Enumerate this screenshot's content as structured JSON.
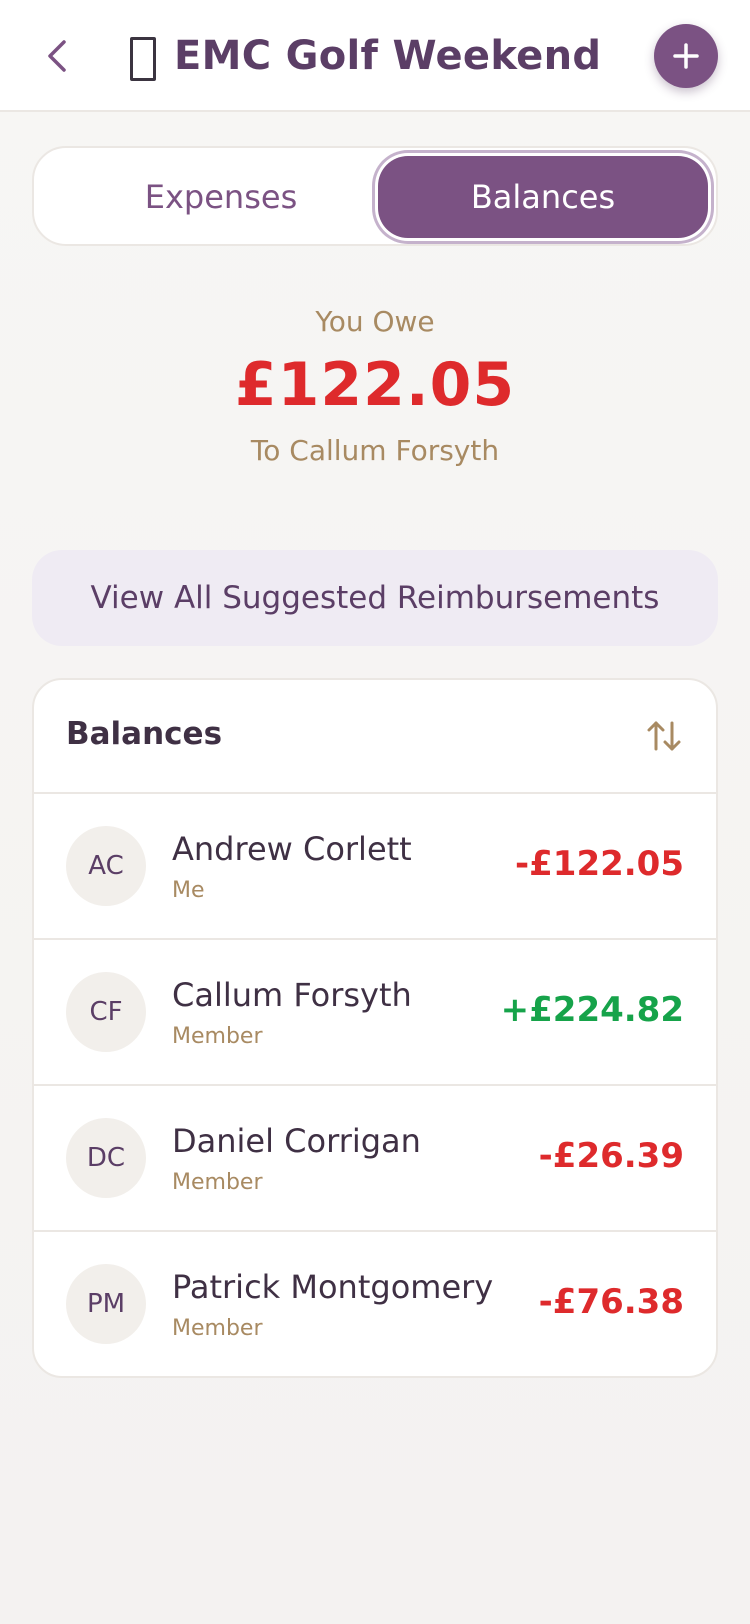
{
  "header": {
    "title": "EMC Golf Weekend",
    "back_icon": "chevron-left-icon",
    "add_icon": "plus-icon"
  },
  "tabs": [
    {
      "label": "Expenses",
      "active": false
    },
    {
      "label": "Balances",
      "active": true
    }
  ],
  "summary": {
    "label": "You Owe",
    "amount": "£122.05",
    "to": "To Callum Forsyth"
  },
  "reimbursements_button": "View All Suggested Reimbursements",
  "balances": {
    "title": "Balances",
    "sort_icon": "sort-arrows-icon",
    "rows": [
      {
        "initials": "AC",
        "name": "Andrew Corlett",
        "role": "Me",
        "amount": "-£122.05"
      },
      {
        "initials": "CF",
        "name": "Callum Forsyth",
        "role": "Member",
        "amount": "+£224.82"
      },
      {
        "initials": "DC",
        "name": "Daniel Corrigan",
        "role": "Member",
        "amount": "-£26.39"
      },
      {
        "initials": "PM",
        "name": "Patrick Montgomery",
        "role": "Member",
        "amount": "-£76.38"
      }
    ]
  },
  "colors": {
    "brand": "#7b5283",
    "negative": "#de2a2c",
    "positive": "#16a34a",
    "muted": "#a88a62"
  }
}
